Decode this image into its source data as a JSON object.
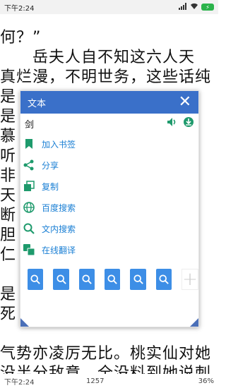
{
  "status_bar": {
    "time": "下午2:24"
  },
  "reader": {
    "lines": [
      "何？”",
      "　　岳夫人自不知这六人天",
      "真烂漫，不明世务，这些话纯",
      "是",
      "是",
      "慕",
      "听",
      "非",
      "天",
      "断",
      "胆",
      "仁",
      "",
      "是",
      "死",
      "",
      "气势亦凌厉无比。桃实仙对她",
      "没半分敌意，全没料到她说刺"
    ]
  },
  "popup": {
    "title": "文本",
    "close": "✕",
    "word": "剑",
    "menu": [
      {
        "icon": "bookmark-icon",
        "label": "加入书签"
      },
      {
        "icon": "share-icon",
        "label": "分享"
      },
      {
        "icon": "copy-icon",
        "label": "复制"
      },
      {
        "icon": "globe-icon",
        "label": "百度搜索"
      },
      {
        "icon": "search-icon",
        "label": "文内搜索"
      },
      {
        "icon": "translate-icon",
        "label": "在线翻译"
      }
    ],
    "search_buttons_count": 6,
    "add_button": "+"
  },
  "footer": {
    "time": "下午2:24",
    "page": "1257",
    "progress": "36%"
  },
  "colors": {
    "popup_header": "#3a70c9",
    "menu_icon": "#1e9a6c",
    "menu_text": "#1a7fd4",
    "search_button": "#3d8ee6"
  }
}
